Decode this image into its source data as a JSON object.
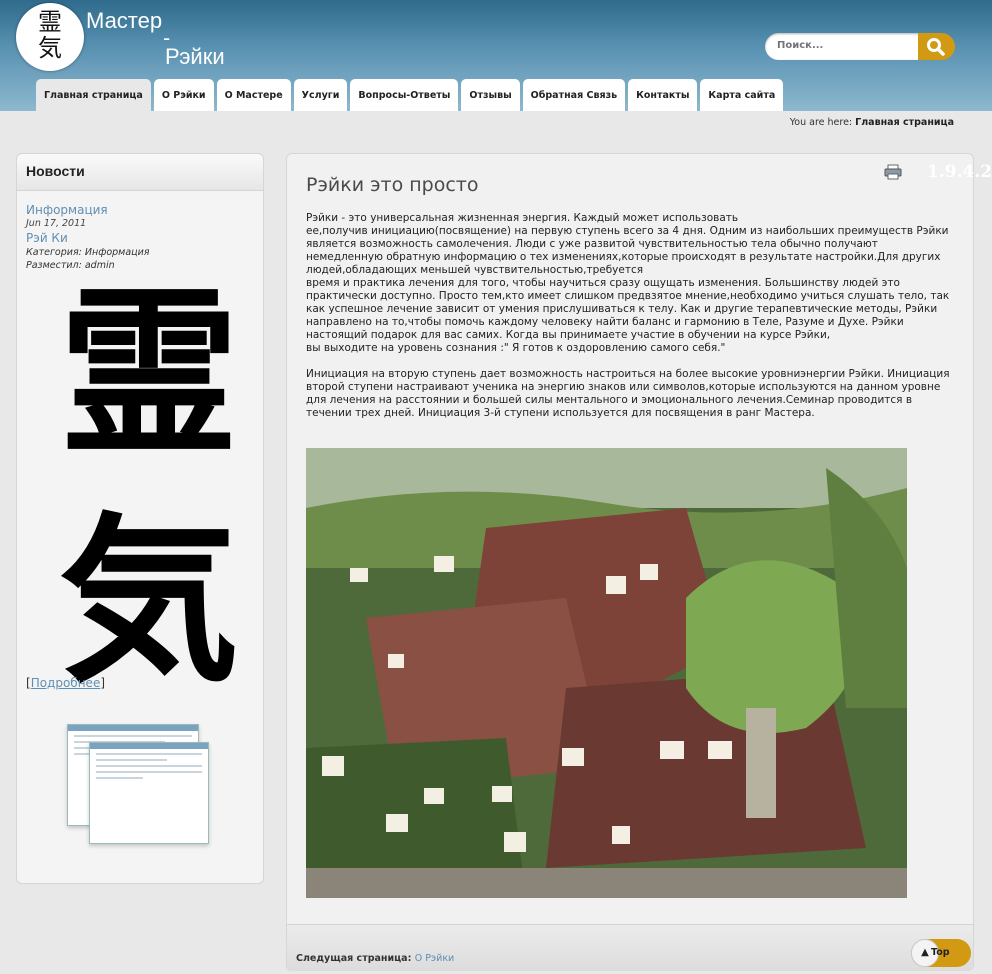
{
  "header": {
    "logo_kanji_1": "霊",
    "logo_kanji_2": "気",
    "title_line1": "Мастер",
    "title_dash": "-",
    "title_line2": "Рэйки",
    "search_placeholder": "Поиск..."
  },
  "nav": {
    "items": [
      {
        "label": "Главная страница"
      },
      {
        "label": "О Рэйки"
      },
      {
        "label": "О Мастере"
      },
      {
        "label": "Услуги"
      },
      {
        "label": "Вопросы-Ответы"
      },
      {
        "label": "Отзывы"
      },
      {
        "label": "Обратная Связь"
      },
      {
        "label": "Контакты"
      },
      {
        "label": "Карта сайта"
      }
    ]
  },
  "breadcrumb": {
    "prefix": "You are here:",
    "current": "Главная страница"
  },
  "sidebar": {
    "title": "Новости",
    "news": {
      "link": "Информация",
      "date": "Jun 17, 2011",
      "name": "Рэй Ки",
      "category": "Категория: Информация",
      "author": "Разместил: admin"
    },
    "kanji_1": "霊",
    "kanji_2": "気",
    "more_open": "[",
    "more_link": "Подробнее",
    "more_close": "]"
  },
  "article": {
    "version": "1.9.4.2",
    "title": "Рэйки это просто",
    "paragraph_1": "Рэйки - это универсальная жизненная энергия. Каждый может использовать\nее,получив инициацию(посвящение) на первую ступень всего за 4 дня. Одним из наибольших преимуществ Рэйки является возможность самолечения. Люди с уже развитой чувствительностью тела обычно получают немедленную обратную информацию о тех изменениях,которые происходят в результате настройки.Для других людей,обладающих меньшей чувствительностью,требуется\nвремя и практика лечения для того, чтобы научиться сразу ощущать изменения. Большинству людей это практически доступно. Просто тем,кто имеет слишком предвзятое мнение,необходимо учиться слушать тело, так как успешное лечение зависит от умения прислушиваться к телу. Как и другие терапевтические методы, Рэйки направлено на то,чтобы помочь каждому человеку найти баланс и гармонию в Теле, Разуме и Духе. Рэйки настоящий подарок для вас самих. Когда вы принимаете участие в обучении на курсе Рэйки,\nвы выходите на уровень сознания :\" Я готов к оздоровлению самого себя.\"",
    "paragraph_2": "Инициация на вторую ступень дает возможность настроиться на более высокие уровниэнергии Рэйки. Инициация второй ступени настраивают ученика на энергию знаков или символов,которые используются на данном уровне для лечения на расстоянии и большей силы ментального и эмоционального лечения.Семинар проводится в течении трех дней. Инициация 3-й ступени используется для посвящения в ранг Мастера."
  },
  "footer": {
    "next_label": "Следущая страница:",
    "next_link": "О Рэйки",
    "top_label": "Top"
  }
}
